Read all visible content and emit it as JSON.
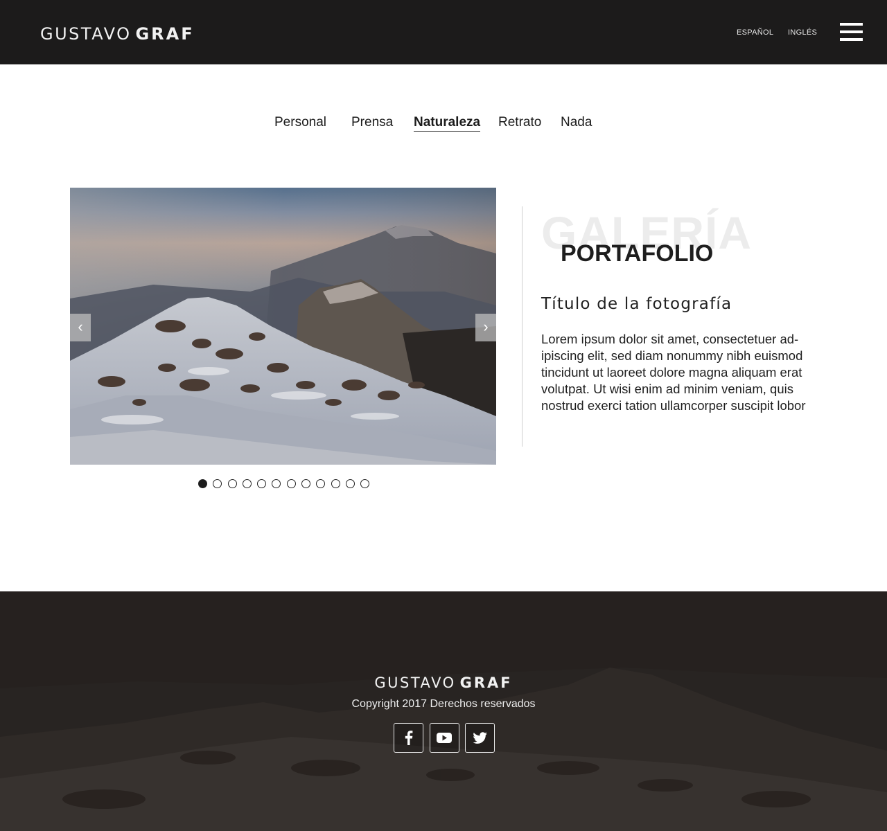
{
  "header": {
    "logo_first": "GUSTAVO",
    "logo_second": "GRAF",
    "lang_es": "ESPAÑOL",
    "lang_en": "INGLÉS",
    "menu_icon": "hamburger-menu-icon"
  },
  "categories": {
    "items": [
      "Personal",
      "Prensa",
      "Naturaleza",
      "Retrato",
      "Nada"
    ],
    "active": "Naturaleza"
  },
  "slider": {
    "prev_label": "‹",
    "next_label": "›",
    "total_slides": 12,
    "active_slide": 1
  },
  "info": {
    "ghost_title": "GALERÍA",
    "section_title": "PORTAFOLIO",
    "photo_title": "Título de la fotografía",
    "description": "Lorem ipsum dolor sit amet, consectetuer ad-ipiscing elit, sed diam nonummy nibh euismod tincidunt ut laoreet dolore magna aliquam erat volutpat. Ut wisi enim ad minim veniam, quis nostrud exerci tation ullamcorper suscipit lobor"
  },
  "footer": {
    "logo_first": "GUSTAVO",
    "logo_second": "GRAF",
    "copyright": "Copyright 2017 Derechos reservados",
    "social": [
      "facebook-icon",
      "youtube-icon",
      "twitter-icon"
    ]
  },
  "colors": {
    "header_bg": "#1c1b1b",
    "footer_bg": "#2a2523",
    "text": "#1b1b1b"
  }
}
